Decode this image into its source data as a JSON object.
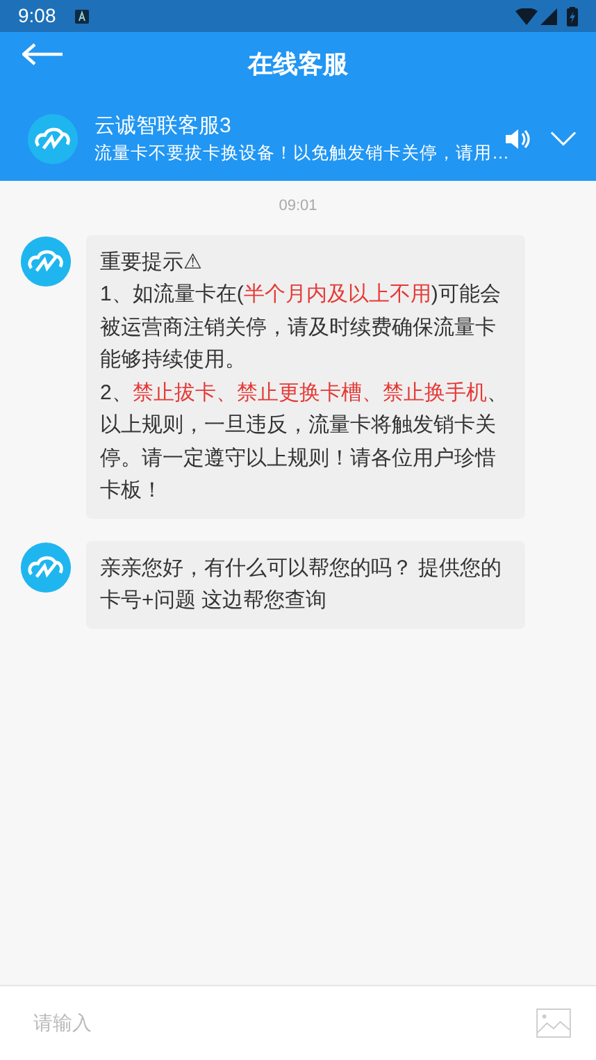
{
  "status_bar": {
    "time": "9:08"
  },
  "header": {
    "title": "在线客服"
  },
  "agent": {
    "name": "云诚智联客服3",
    "notice": "流量卡不要拔卡换设备！以免触发销卡关停，请用…",
    "sound_on": true
  },
  "timestamp": "09:01",
  "messages": [
    {
      "paragraphs": [
        [
          {
            "text": "重要提示⚠",
            "highlight": false
          }
        ],
        [
          {
            "text": "1、如流量卡在(",
            "highlight": false
          },
          {
            "text": "半个月内及以上不用",
            "highlight": true
          },
          {
            "text": ")可能会被运营商注销关停，请及时续费确保流量卡能够持续使用。",
            "highlight": false
          }
        ],
        [
          {
            "text": "2、",
            "highlight": false
          },
          {
            "text": "禁止拔卡、禁止更换卡槽、禁止换手机",
            "highlight": true
          },
          {
            "text": "、以上规则，一旦违反，流量卡将触发销卡关停。请一定遵守以上规则！请各位用户珍惜卡板！",
            "highlight": false
          }
        ]
      ]
    },
    {
      "paragraphs": [
        [
          {
            "text": "亲亲您好，有什么可以帮您的吗？ 提供您的卡号+问题 这边帮您查询",
            "highlight": false
          }
        ]
      ]
    }
  ],
  "input": {
    "placeholder": "请输入"
  }
}
